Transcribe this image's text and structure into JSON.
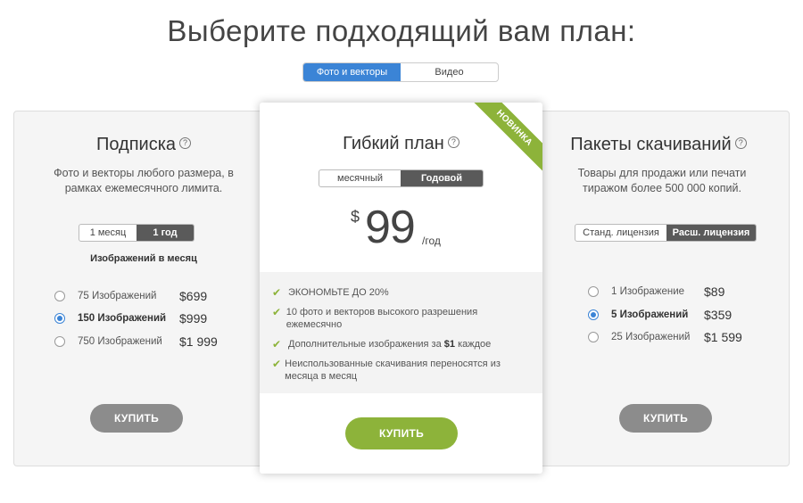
{
  "title": "Выберите подходящий вам план:",
  "type_toggle": {
    "options": [
      "Фото и векторы",
      "Видео"
    ],
    "active": 0
  },
  "subscription": {
    "title": "Подписка",
    "description": "Фото и векторы любого размера, в рамках ежемесячного лимита.",
    "period_options": [
      "1 месяц",
      "1 год"
    ],
    "period_active": 1,
    "per_month_label": "Изображений в месяц",
    "plans": [
      {
        "count": "75",
        "unit": "Изображений",
        "price": "$699",
        "selected": false
      },
      {
        "count": "150",
        "unit": "Изображений",
        "price": "$999",
        "selected": true
      },
      {
        "count": "750",
        "unit": "Изображений",
        "price": "$1 999",
        "selected": false
      }
    ],
    "buy_label": "КУПИТЬ"
  },
  "flexible": {
    "title": "Гибкий план",
    "ribbon": "НОВИНКА",
    "period_options": [
      "месячный",
      "Годовой"
    ],
    "period_active": 1,
    "currency": "$",
    "price": "99",
    "per": "/год",
    "features": [
      {
        "text": "ЭКОНОМЬТЕ ДО 20%"
      },
      {
        "text": "10 фото и векторов высокого разрешения ежемесячно"
      },
      {
        "prefix": "Дополнительные изображения за ",
        "bold": "$1",
        "suffix": " каждое"
      },
      {
        "text": "Неиспользованные скачивания переносятся из месяца в месяц"
      }
    ],
    "buy_label": "КУПИТЬ"
  },
  "packs": {
    "title": "Пакеты скачиваний",
    "description": "Товары для продажи или печати тиражом более 500 000 копий.",
    "license_options": [
      "Станд. лицензия",
      "Расш. лицензия"
    ],
    "license_active": 1,
    "plans": [
      {
        "count": "1",
        "unit": "Изображение",
        "price": "$89",
        "selected": false
      },
      {
        "count": "5",
        "unit": "Изображений",
        "price": "$359",
        "selected": true
      },
      {
        "count": "25",
        "unit": "Изображений",
        "price": "$1 599",
        "selected": false
      }
    ],
    "buy_label": "КУПИТЬ"
  },
  "colors": {
    "accent_blue": "#3b84d6",
    "accent_green": "#8db33a",
    "button_grey": "#8c8c8c"
  }
}
